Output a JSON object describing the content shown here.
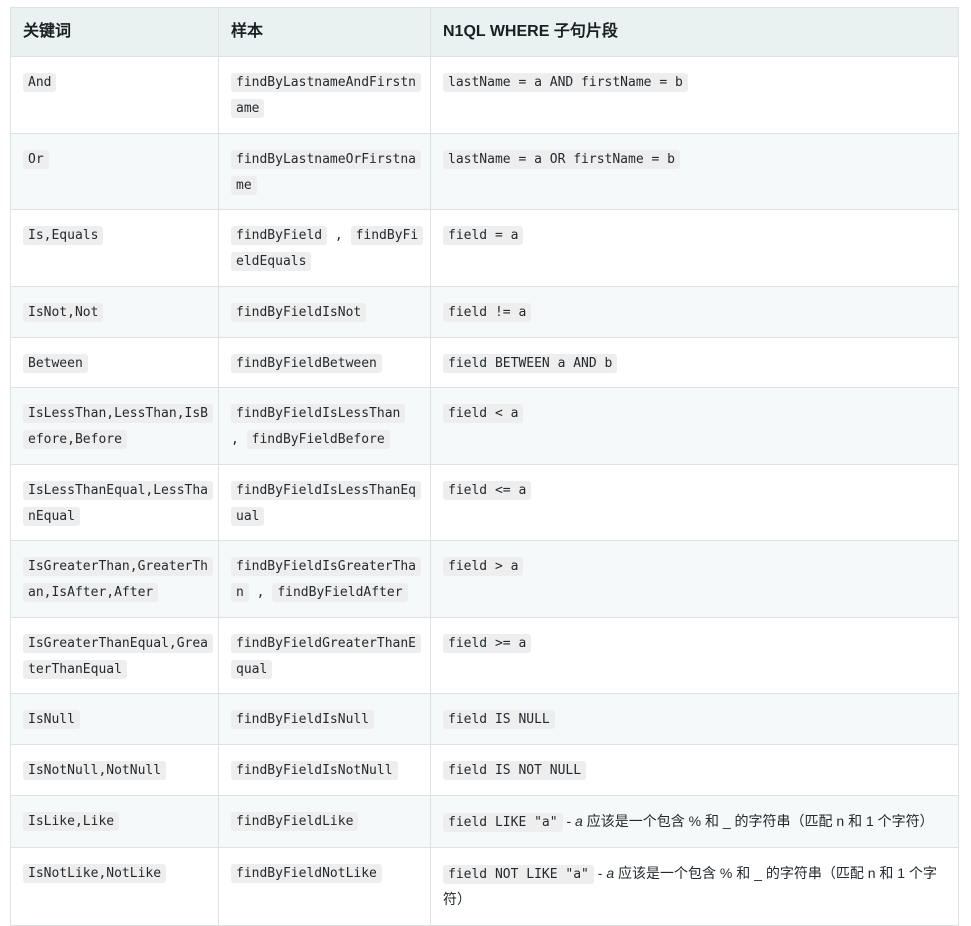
{
  "table": {
    "headers": [
      "关键词",
      "样本",
      "N1QL WHERE 子句片段"
    ],
    "rows": [
      {
        "keyword": "And",
        "sample_parts": [
          "findByLastnameAndFirstname"
        ],
        "sample_sep": "",
        "clause_code": "lastName = a AND firstName = b",
        "clause_note": ""
      },
      {
        "keyword": "Or",
        "sample_parts": [
          "findByLastnameOrFirstname"
        ],
        "sample_sep": "",
        "clause_code": "lastName = a OR firstName = b",
        "clause_note": ""
      },
      {
        "keyword": "Is,Equals",
        "sample_parts": [
          "findByField",
          "findByFieldEquals"
        ],
        "sample_sep": ",",
        "clause_code": "field = a",
        "clause_note": ""
      },
      {
        "keyword": "IsNot,Not",
        "sample_parts": [
          "findByFieldIsNot"
        ],
        "sample_sep": "",
        "clause_code": "field != a",
        "clause_note": ""
      },
      {
        "keyword": "Between",
        "sample_parts": [
          "findByFieldBetween"
        ],
        "sample_sep": "",
        "clause_code": "field BETWEEN a AND b",
        "clause_note": ""
      },
      {
        "keyword": "IsLessThan,LessThan,IsBefore,Before",
        "sample_parts": [
          "findByFieldIsLessThan",
          "findByFieldBefore"
        ],
        "sample_sep": ",",
        "clause_code": "field < a",
        "clause_note": ""
      },
      {
        "keyword": "IsLessThanEqual,LessThanEqual",
        "sample_parts": [
          "findByFieldIsLessThanEqual"
        ],
        "sample_sep": "",
        "clause_code": "field <= a",
        "clause_note": ""
      },
      {
        "keyword": "IsGreaterThan,GreaterThan,IsAfter,After",
        "sample_parts": [
          "findByFieldIsGreaterThan",
          "findByFieldAfter"
        ],
        "sample_sep": ",",
        "clause_code": "field > a",
        "clause_note": ""
      },
      {
        "keyword": "IsGreaterThanEqual,GreaterThanEqual",
        "sample_parts": [
          "findByFieldGreaterThanEqual"
        ],
        "sample_sep": "",
        "clause_code": "field >= a",
        "clause_note": ""
      },
      {
        "keyword": "IsNull",
        "sample_parts": [
          "findByFieldIsNull"
        ],
        "sample_sep": "",
        "clause_code": "field IS NULL",
        "clause_note": ""
      },
      {
        "keyword": "IsNotNull,NotNull",
        "sample_parts": [
          "findByFieldIsNotNull"
        ],
        "sample_sep": "",
        "clause_code": "field IS NOT NULL",
        "clause_note": ""
      },
      {
        "keyword": "IsLike,Like",
        "sample_parts": [
          "findByFieldLike"
        ],
        "sample_sep": "",
        "clause_code": "field LIKE \"a\"",
        "clause_note_prefix": " - ",
        "clause_note_italic": "a",
        "clause_note": " 应该是一个包含 % 和 _ 的字符串（匹配 n 和 1 个字符）"
      },
      {
        "keyword": "IsNotLike,NotLike",
        "sample_parts": [
          "findByFieldNotLike"
        ],
        "sample_sep": "",
        "clause_code": "field NOT LIKE \"a\"",
        "clause_note_prefix": " - ",
        "clause_note_italic": "a",
        "clause_note": " 应该是一个包含 % 和 _ 的字符串（匹配 n 和 1 个字符）"
      }
    ]
  },
  "colors": {
    "header_bg": "#eaf1f1",
    "border": "#dfe2e5",
    "row_odd_bg": "#ffffff",
    "row_even_bg": "#f5f9fa",
    "code_bg": "#eeeeee",
    "text": "#24292e"
  }
}
